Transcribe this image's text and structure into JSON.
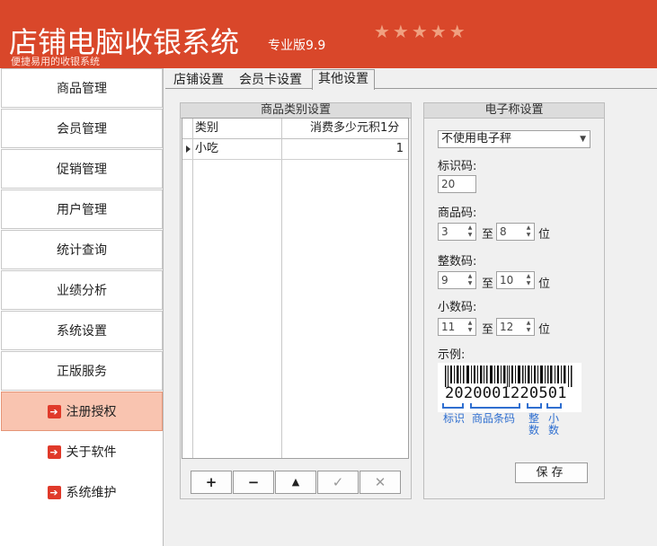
{
  "header": {
    "title": "店铺电脑收银系统",
    "edition": "专业版9.9",
    "subtitle": "便捷易用的收银系统",
    "stars": "★★★★★"
  },
  "sidebar": {
    "items": [
      {
        "label": "商品管理"
      },
      {
        "label": "会员管理"
      },
      {
        "label": "促销管理"
      },
      {
        "label": "用户管理"
      },
      {
        "label": "统计查询"
      },
      {
        "label": "业绩分析"
      },
      {
        "label": "系统设置"
      },
      {
        "label": "正版服务"
      },
      {
        "label": "注册授权"
      },
      {
        "label": "关于软件"
      },
      {
        "label": "系统维护"
      }
    ]
  },
  "tabs": [
    {
      "label": "店铺设置"
    },
    {
      "label": "会员卡设置"
    },
    {
      "label": "其他设置"
    }
  ],
  "category": {
    "title": "商品类别设置",
    "columns": [
      "类别",
      "消费多少元积1分"
    ],
    "rows": [
      {
        "category": "小吃",
        "points": "1"
      }
    ],
    "buttons": {
      "add": "+",
      "remove": "−",
      "up": "▲",
      "confirm": "✓",
      "cancel": "✕"
    }
  },
  "scale": {
    "title": "电子称设置",
    "mode": "不使用电子秤",
    "tag_label": "标识码:",
    "tag_value": "20",
    "product_label": "商品码:",
    "product_from": "3",
    "product_to": "8",
    "integer_label": "整数码:",
    "integer_from": "9",
    "integer_to": "10",
    "decimal_label": "小数码:",
    "decimal_from": "11",
    "decimal_to": "12",
    "to": "至",
    "unit": "位",
    "example_label": "示例:",
    "example_code": "2020001220501",
    "legend": {
      "tag": "标识",
      "product": "商品条码",
      "integer": "整数",
      "decimal": "小数"
    },
    "save": "保存"
  },
  "colors": {
    "header": "#d9472a",
    "active_item": "#f9c4b0",
    "accent_blue": "#2f6fd0"
  }
}
